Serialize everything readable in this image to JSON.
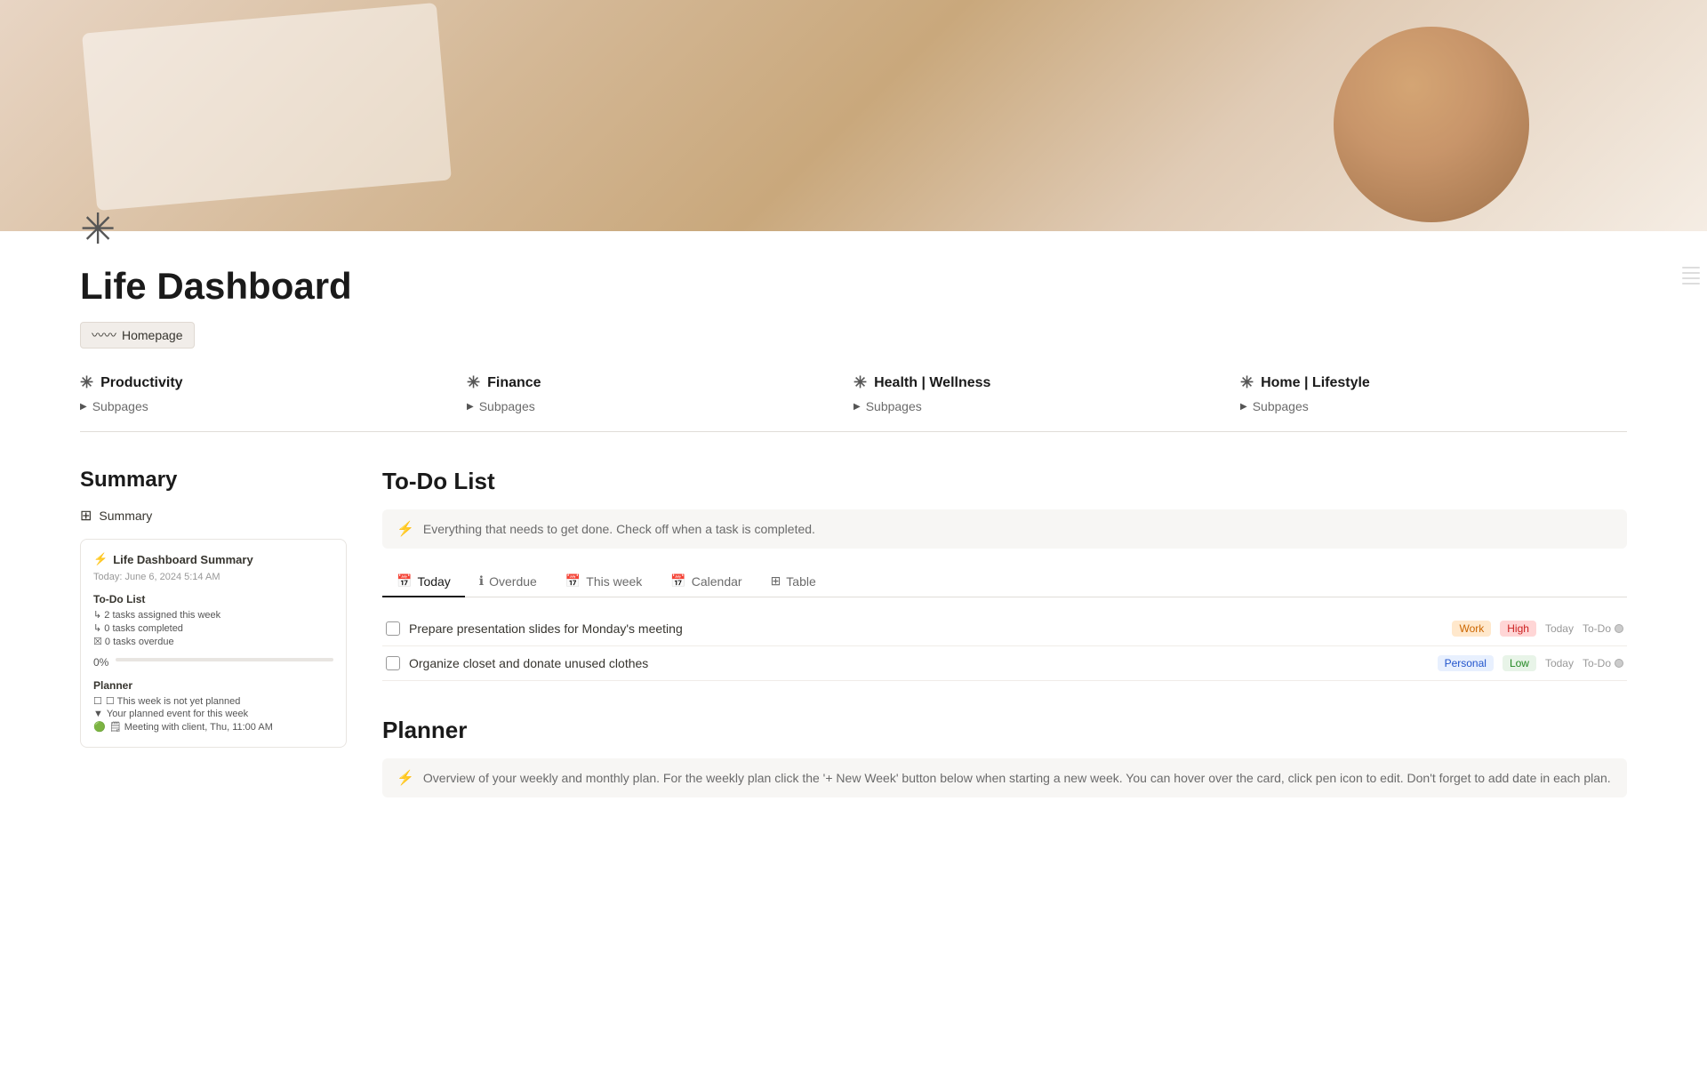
{
  "hero": {
    "alt": "Coffee and planner desktop"
  },
  "page": {
    "icon": "✳",
    "title": "Life Dashboard",
    "homepage_badge": "Homepage"
  },
  "nav": {
    "sections": [
      {
        "icon": "✳",
        "label": "Productivity",
        "subpages": "Subpages"
      },
      {
        "icon": "✳",
        "label": "Finance",
        "subpages": "Subpages"
      },
      {
        "icon": "✳",
        "label": "Health | Wellness",
        "subpages": "Subpages"
      },
      {
        "icon": "✳",
        "label": "Home | Lifestyle",
        "subpages": "Subpages"
      }
    ]
  },
  "sidebar": {
    "title": "Summary",
    "summary_link": "Summary",
    "card": {
      "icon": "⚡",
      "title": "Life Dashboard Summary",
      "date": "Today: June 6, 2024 5:14 AM",
      "todo_label": "To-Do List",
      "todo_items": [
        "↳ 2 tasks assigned this week",
        "↳ 0 tasks completed",
        "☒ 0 tasks overdue"
      ],
      "progress_text": "0%",
      "planner_label": "Planner",
      "planner_items": [
        "☐ This week is not yet planned",
        "▼ Your planned event for this week",
        "🟢 🗒 Meeting with client, Thu, 11:00 AM"
      ]
    }
  },
  "todo": {
    "section_title": "To-Do List",
    "info_text": "Everything that needs to get done. Check off when a task is completed.",
    "info_icon": "⚡",
    "tabs": [
      {
        "icon": "📅",
        "label": "Today",
        "active": true
      },
      {
        "icon": "ℹ",
        "label": "Overdue",
        "active": false
      },
      {
        "icon": "📅",
        "label": "This week",
        "active": false
      },
      {
        "icon": "📅",
        "label": "Calendar",
        "active": false
      },
      {
        "icon": "⊞",
        "label": "Table",
        "active": false
      }
    ],
    "tasks": [
      {
        "text": "Prepare presentation slides for Monday's meeting",
        "category": "Work",
        "priority": "High",
        "date": "Today",
        "status": "To-Do"
      },
      {
        "text": "Organize closet and donate unused clothes",
        "category": "Personal",
        "priority": "Low",
        "date": "Today",
        "status": "To-Do"
      }
    ]
  },
  "planner": {
    "section_title": "Planner",
    "info_text": "Overview of your weekly and monthly plan. For the weekly plan click the '+ New Week' button below when starting a new week. You can hover over the card, click pen icon to edit. Don't forget to add date in each plan.",
    "info_icon": "⚡"
  }
}
